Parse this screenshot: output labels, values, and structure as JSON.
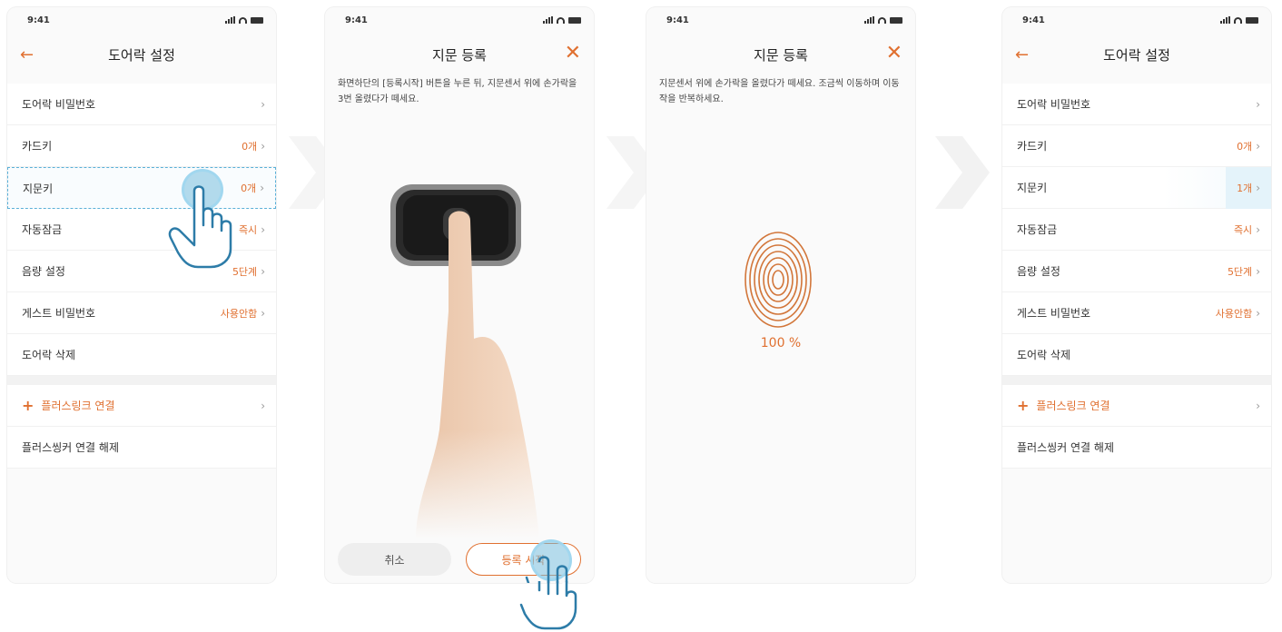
{
  "screens": [
    {
      "status": {
        "time": "9:41"
      },
      "nav": {
        "back": "←",
        "title": "도어락 설정"
      },
      "rows": [
        {
          "label": "도어락 비밀번호",
          "value": ""
        },
        {
          "label": "카드키",
          "value": "0개"
        },
        {
          "label": "지문키",
          "value": "0개"
        },
        {
          "label": "자동잠금",
          "value": "즉시"
        },
        {
          "label": "음량 설정",
          "value": "5단계"
        },
        {
          "label": "게스트 비밀번호",
          "value": "사용안함"
        },
        {
          "label": "도어락 삭제",
          "value": ""
        }
      ],
      "plus_link": "플러스링크 연결",
      "unlink": "플러스씽커 연결 해제"
    },
    {
      "status": {
        "time": "9:41"
      },
      "nav": {
        "title": "지문 등록",
        "close": "✕"
      },
      "instruction": "화면하단의 [등록시작] 버튼을 누른 뒤, 지문센서 위에 손가락을 3번 올렸다가 떼세요.",
      "buttons": {
        "cancel": "취소",
        "register": "등록 시작"
      }
    },
    {
      "status": {
        "time": "9:41"
      },
      "nav": {
        "title": "지문 등록",
        "close": "✕"
      },
      "instruction": "지문센서 위에 손가락을 올렸다가 떼세요. 조금씩 이동하며 이동작을 반복하세요.",
      "progress": "100 %"
    },
    {
      "status": {
        "time": "9:41"
      },
      "nav": {
        "back": "←",
        "title": "도어락 설정"
      },
      "rows": [
        {
          "label": "도어락 비밀번호",
          "value": ""
        },
        {
          "label": "카드키",
          "value": "0개"
        },
        {
          "label": "지문키",
          "value": "1개"
        },
        {
          "label": "자동잠금",
          "value": "즉시"
        },
        {
          "label": "음량 설정",
          "value": "5단계"
        },
        {
          "label": "게스트 비밀번호",
          "value": "사용안함"
        },
        {
          "label": "도어락 삭제",
          "value": ""
        }
      ],
      "plus_link": "플러스링크 연결",
      "unlink": "플러스씽커 연결 해제"
    }
  ],
  "colors": {
    "accent": "#e07030",
    "highlight": "#5ab0d8"
  },
  "icons": [
    "back-arrow-icon",
    "close-icon",
    "chevron-right-icon",
    "plus-icon",
    "fingerprint-icon",
    "hand-pointer-icon",
    "signal-icon",
    "wifi-icon",
    "battery-icon"
  ]
}
